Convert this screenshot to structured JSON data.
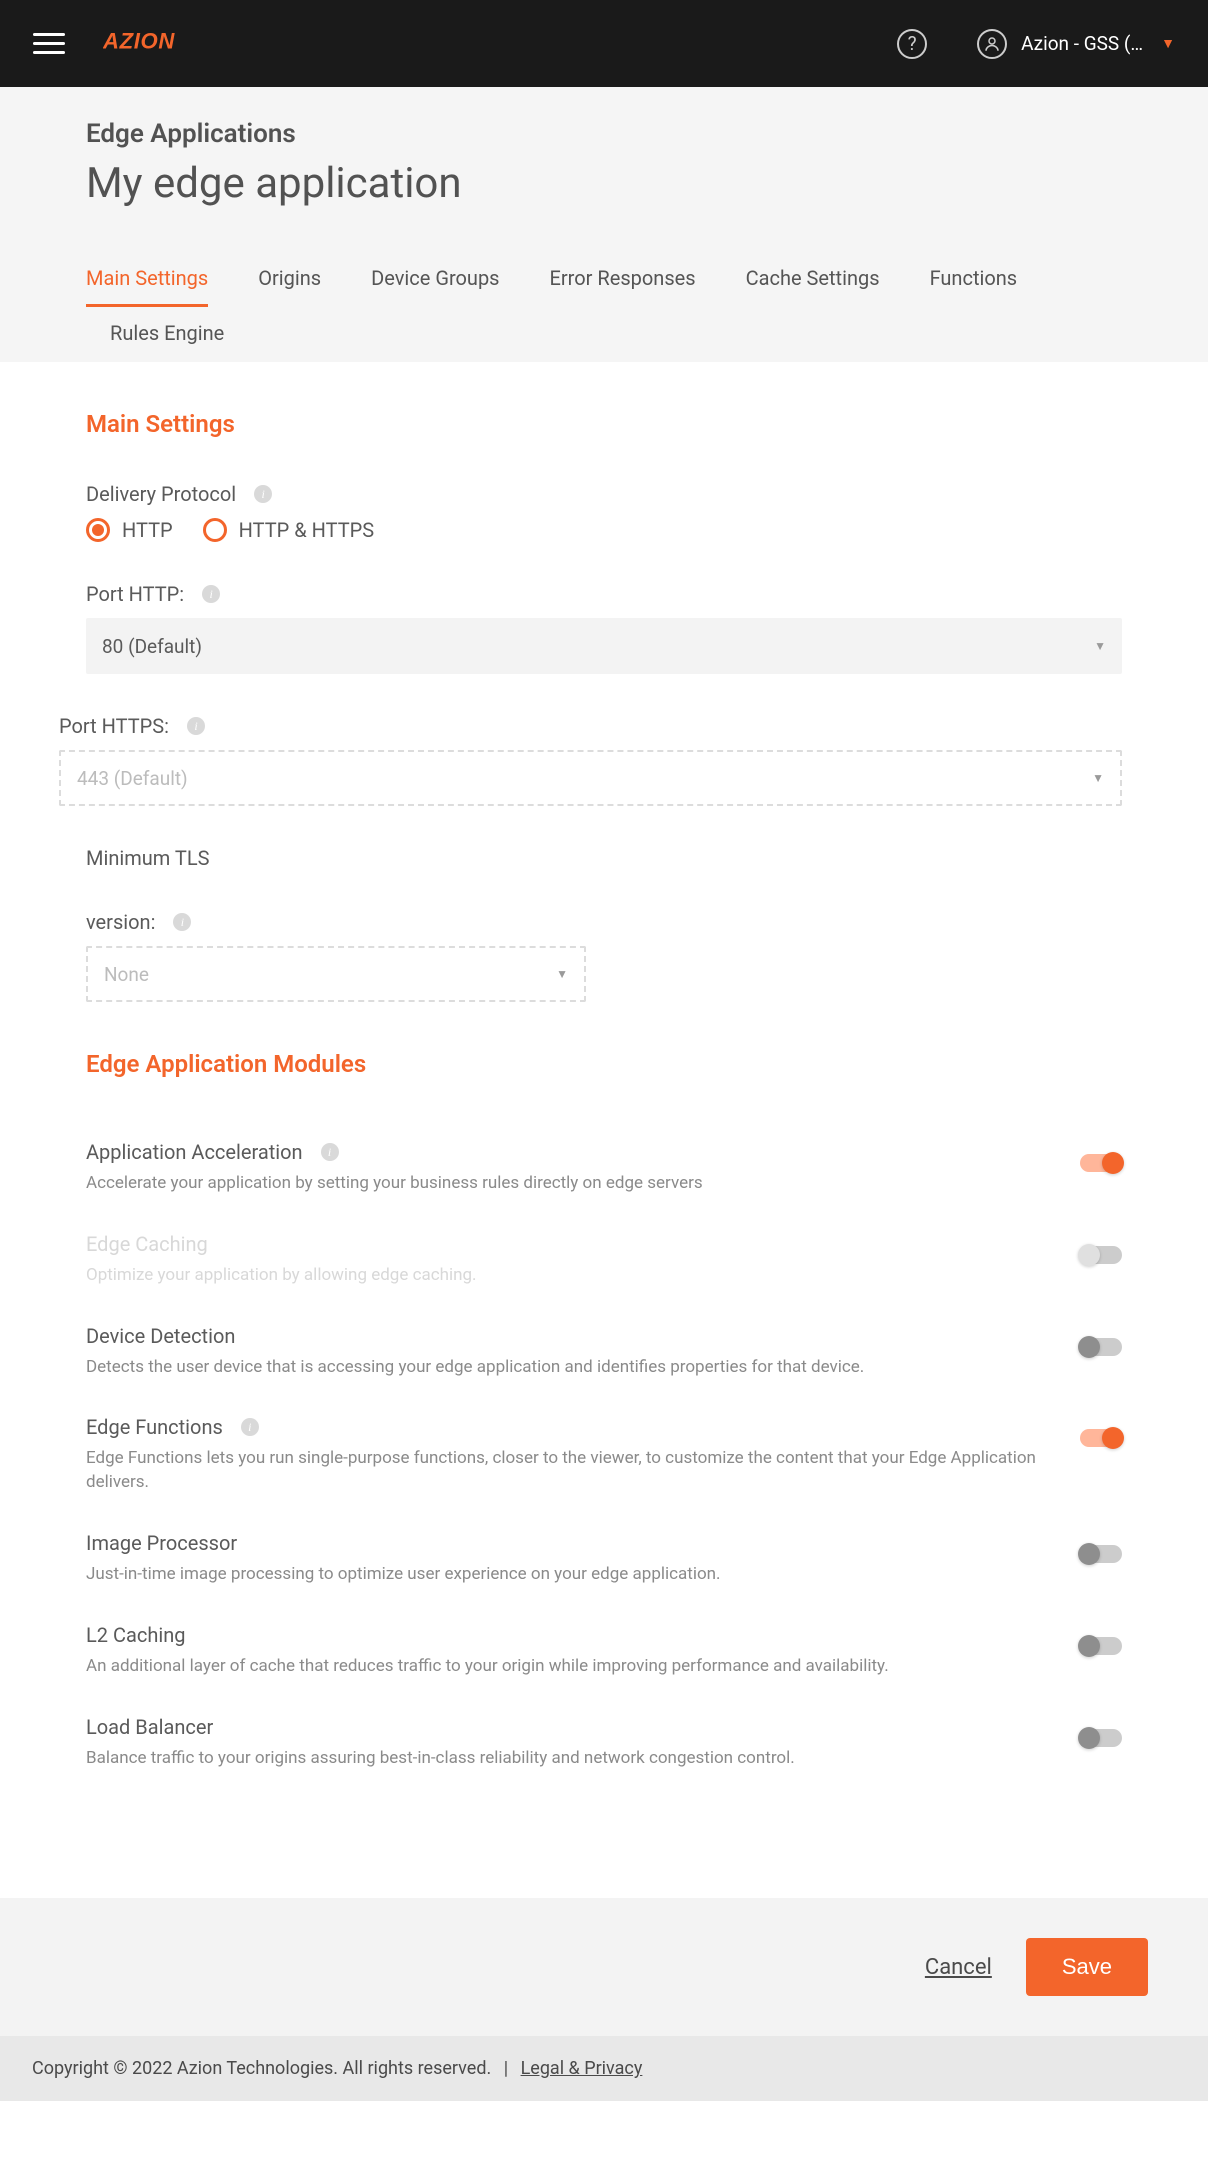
{
  "header": {
    "user_label": "Azion - GSS (…",
    "help_symbol": "?"
  },
  "page": {
    "breadcrumb": "Edge Applications",
    "title": "My edge application"
  },
  "tabs": [
    {
      "label": "Main Settings",
      "active": true
    },
    {
      "label": "Origins"
    },
    {
      "label": "Device Groups"
    },
    {
      "label": "Error Responses"
    },
    {
      "label": "Cache Settings"
    },
    {
      "label": "Functions"
    },
    {
      "label": "Rules Engine"
    }
  ],
  "main_settings": {
    "section_title": "Main Settings",
    "delivery_protocol_label": "Delivery Protocol",
    "radio_http": "HTTP",
    "radio_http_https": "HTTP & HTTPS",
    "port_http_label": "Port HTTP:",
    "port_http_value": "80 (Default)",
    "port_https_label": "Port HTTPS:",
    "port_https_value": "443 (Default)",
    "min_tls_label1": "Minimum TLS",
    "min_tls_label2": "version:",
    "min_tls_value": "None"
  },
  "modules": {
    "section_title": "Edge Application Modules",
    "items": [
      {
        "name": "Application Acceleration",
        "desc": "Accelerate your application by setting your business rules directly on edge servers",
        "on": true,
        "info": true
      },
      {
        "name": "Edge Caching",
        "desc": "Optimize your application by allowing edge caching.",
        "disabled": true,
        "light": true
      },
      {
        "name": "Device Detection",
        "desc": "Detects the user device that is accessing your edge application and identifies properties for that device."
      },
      {
        "name": "Edge Functions",
        "desc": "Edge Functions lets you run single-purpose functions, closer to the viewer, to customize the content that your Edge Application delivers.",
        "on": true,
        "info": true
      },
      {
        "name": "Image Processor",
        "desc": "Just-in-time image processing to optimize user experience on your edge application."
      },
      {
        "name": "L2 Caching",
        "desc": "An additional layer of cache that reduces traffic to your origin while improving performance and availability."
      },
      {
        "name": "Load Balancer",
        "desc": "Balance traffic to your origins assuring best-in-class reliability and network congestion control."
      }
    ]
  },
  "actions": {
    "cancel": "Cancel",
    "save": "Save"
  },
  "footer": {
    "copyright": "Copyright © 2022 Azion Technologies. All rights reserved.",
    "legal": "Legal & Privacy"
  }
}
